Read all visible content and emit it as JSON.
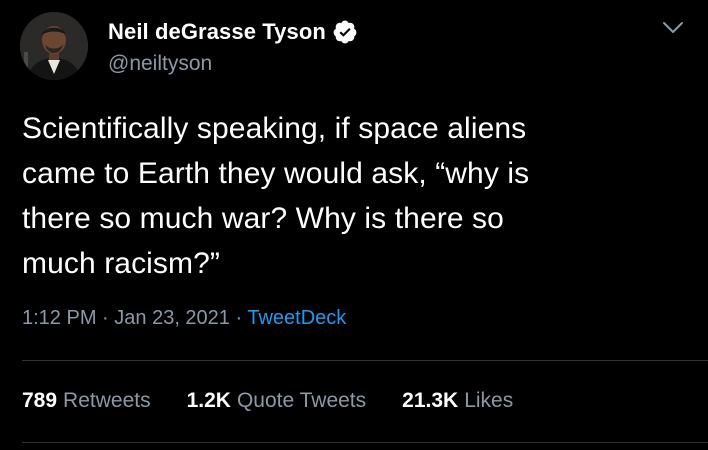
{
  "author": {
    "display_name": "Neil deGrasse Tyson",
    "handle": "@neiltyson",
    "verified": true
  },
  "tweet": {
    "text": "Scientifically speaking, if space aliens\ncame to Earth they would ask, “why is\nthere so much war? Why is there so\nmuch racism?”",
    "time": "1:12 PM",
    "separator": "·",
    "date": "Jan 23, 2021",
    "source": "TweetDeck"
  },
  "stats": {
    "retweets_count": "789",
    "retweets_label": "Retweets",
    "quotes_count": "1.2K",
    "quotes_label": "Quote Tweets",
    "likes_count": "21.3K",
    "likes_label": "Likes"
  },
  "icons": {
    "verified": "verified-badge-icon",
    "menu": "chevron-down-icon"
  },
  "colors": {
    "background": "#000000",
    "text": "#ffffff",
    "secondary_text": "#8b98a5",
    "link": "#1d9bf0",
    "divider": "#2f3336"
  }
}
